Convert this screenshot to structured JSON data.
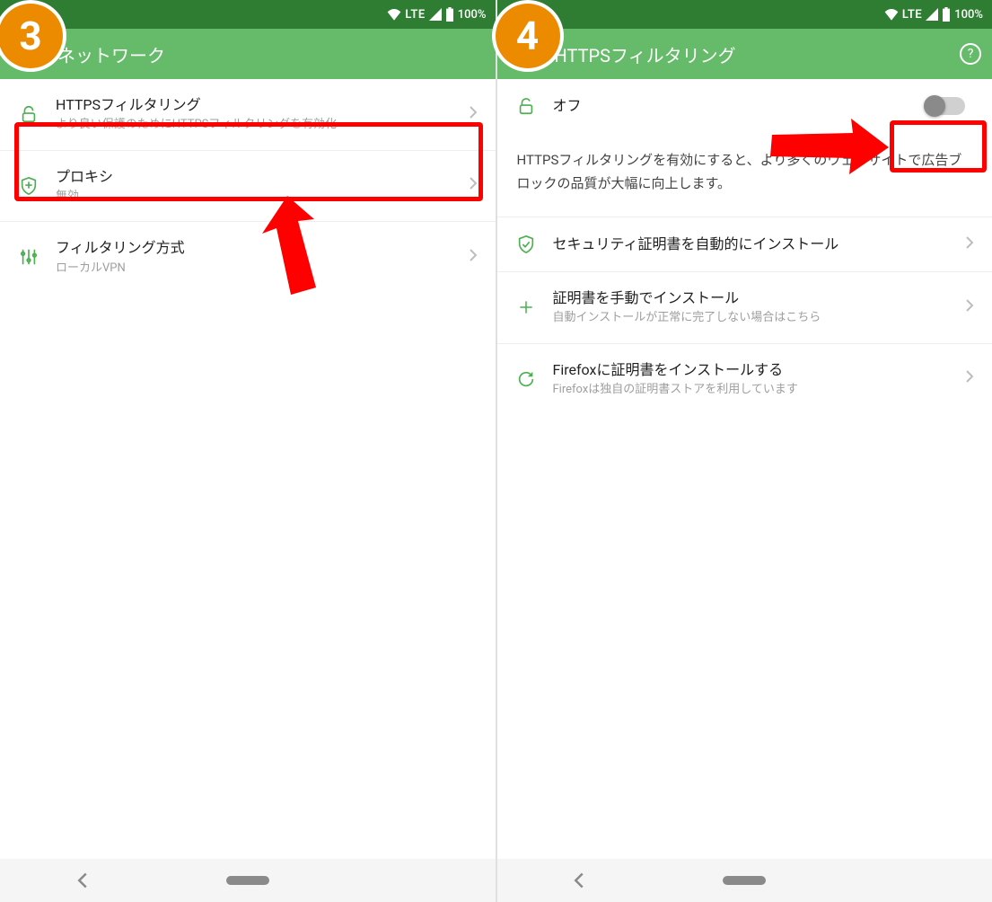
{
  "left": {
    "badge": "3",
    "status": {
      "lte": "LTE",
      "battery": "100%"
    },
    "app_bar": {
      "title": "ネットワーク"
    },
    "items": [
      {
        "title": "HTTPSフィルタリング",
        "sub": "より良い保護のためにHTTPSフィルタリングを有効化"
      },
      {
        "title": "プロキシ",
        "sub": "無効"
      },
      {
        "title": "フィルタリング方式",
        "sub": "ローカルVPN"
      }
    ]
  },
  "right": {
    "badge": "4",
    "status": {
      "lte": "LTE",
      "battery": "100%"
    },
    "app_bar": {
      "title": "HTTPSフィルタリング"
    },
    "toggle": {
      "label": "オフ"
    },
    "description": "HTTPSフィルタリングを有効にすると、より多くのウェブサイトで広告ブロックの品質が大幅に向上します。",
    "items": [
      {
        "title": "セキュリティ証明書を自動的にインストール",
        "sub": ""
      },
      {
        "title": "証明書を手動でインストール",
        "sub": "自動インストールが正常に完了しない場合はこちら"
      },
      {
        "title": "Firefoxに証明書をインストールする",
        "sub": "Firefoxは独自の証明書ストアを利用しています"
      }
    ]
  }
}
